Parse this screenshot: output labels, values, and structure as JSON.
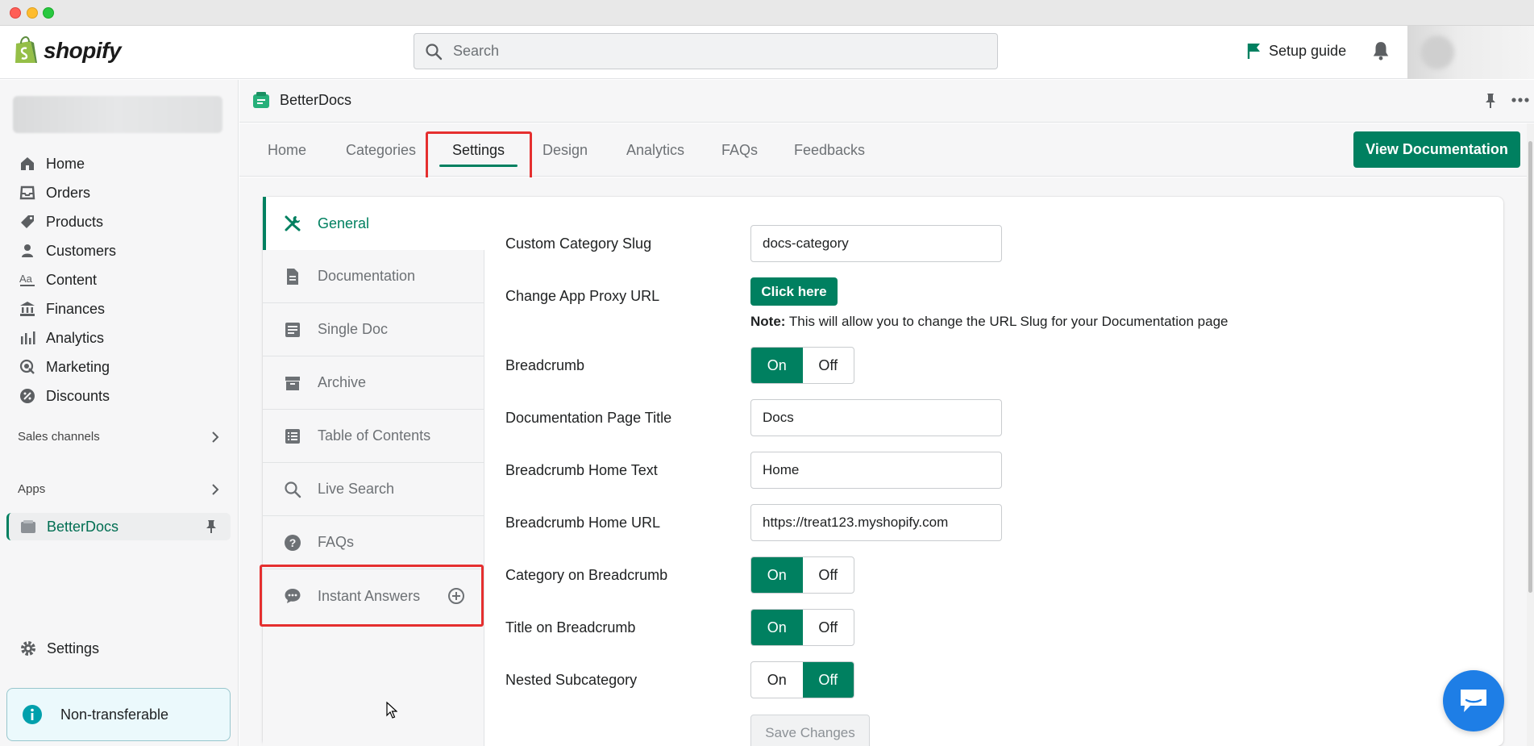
{
  "topbar": {
    "logo_text": "shopify",
    "search_placeholder": "Search",
    "setup_guide": "Setup guide"
  },
  "sidebar": {
    "items": [
      {
        "label": "Home",
        "icon": "home-icon"
      },
      {
        "label": "Orders",
        "icon": "inbox-icon"
      },
      {
        "label": "Products",
        "icon": "tag-icon"
      },
      {
        "label": "Customers",
        "icon": "person-icon"
      },
      {
        "label": "Content",
        "icon": "text-icon"
      },
      {
        "label": "Finances",
        "icon": "bank-icon"
      },
      {
        "label": "Analytics",
        "icon": "bar-chart-icon"
      },
      {
        "label": "Marketing",
        "icon": "target-icon"
      },
      {
        "label": "Discounts",
        "icon": "discount-icon"
      }
    ],
    "sales_channels": "Sales channels",
    "apps": "Apps",
    "betterdocs": "BetterDocs",
    "settings": "Settings",
    "non_transferable": "Non-transferable"
  },
  "app": {
    "title": "BetterDocs",
    "tabs": [
      "Home",
      "Categories",
      "Settings",
      "Design",
      "Analytics",
      "FAQs",
      "Feedbacks"
    ],
    "active_tab": "Settings",
    "view_documentation": "View Documentation"
  },
  "settings_menu": {
    "items": [
      {
        "label": "General",
        "icon": "tools-icon",
        "active": true
      },
      {
        "label": "Documentation",
        "icon": "document-icon",
        "active": false
      },
      {
        "label": "Single Doc",
        "icon": "single-doc-icon",
        "active": false
      },
      {
        "label": "Archive",
        "icon": "archive-icon",
        "active": false
      },
      {
        "label": "Table of Contents",
        "icon": "list-icon",
        "active": false
      },
      {
        "label": "Live Search",
        "icon": "search-icon",
        "active": false
      },
      {
        "label": "FAQs",
        "icon": "question-icon",
        "active": false
      },
      {
        "label": "Instant Answers",
        "icon": "chat-icon",
        "active": false
      }
    ]
  },
  "form": {
    "custom_category_slug": {
      "label": "Custom Category Slug",
      "value": "docs-category"
    },
    "change_app_proxy": {
      "label": "Change App Proxy URL",
      "button": "Click here",
      "note_bold": "Note:",
      "note_text": " This will allow you to change the URL Slug for your Documentation page"
    },
    "breadcrumb": {
      "label": "Breadcrumb",
      "on": "On",
      "off": "Off",
      "value": "On"
    },
    "doc_page_title": {
      "label": "Documentation Page Title",
      "value": "Docs"
    },
    "breadcrumb_home_text": {
      "label": "Breadcrumb Home Text",
      "value": "Home"
    },
    "breadcrumb_home_url": {
      "label": "Breadcrumb Home URL",
      "value": "https://treat123.myshopify.com"
    },
    "category_on_breadcrumb": {
      "label": "Category on Breadcrumb",
      "on": "On",
      "off": "Off",
      "value": "On"
    },
    "title_on_breadcrumb": {
      "label": "Title on Breadcrumb",
      "on": "On",
      "off": "Off",
      "value": "On"
    },
    "nested_subcategory": {
      "label": "Nested Subcategory",
      "on": "On",
      "off": "Off",
      "value": "Off"
    },
    "save": "Save Changes"
  },
  "colors": {
    "primary": "#008060",
    "highlight": "#e52f2f",
    "chat": "#1e7ee6"
  }
}
